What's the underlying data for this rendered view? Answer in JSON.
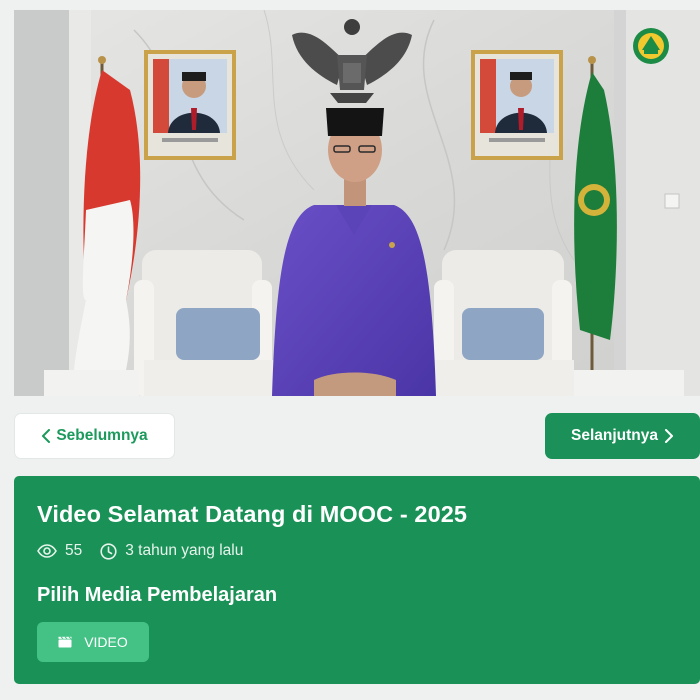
{
  "nav": {
    "prev_label": "Sebelumnya",
    "next_label": "Selanjutnya"
  },
  "video": {
    "title": "Video Selamat Datang di MOOC - 2025",
    "views": "55",
    "posted": "3 tahun yang lalu"
  },
  "media": {
    "heading": "Pilih Media Pembelajaran",
    "items": [
      {
        "label": "VIDEO",
        "icon": "film-clapper-icon"
      }
    ]
  },
  "colors": {
    "primary": "#1a9157",
    "accent": "#44c285",
    "prev_text": "#1c9a5c",
    "background": "#eef1ef"
  }
}
